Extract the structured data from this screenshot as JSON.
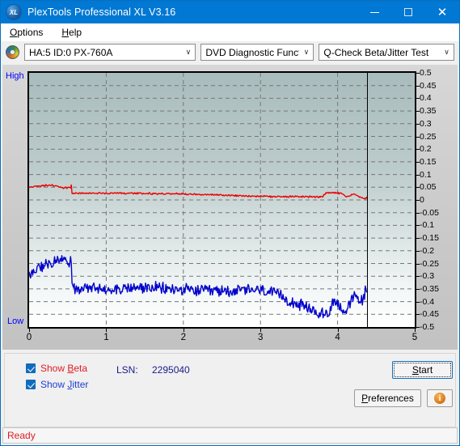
{
  "window": {
    "title": "PlexTools Professional XL V3.16",
    "app_icon": "xl-badge-icon",
    "minimize_label": "–",
    "maximize_label": "□",
    "close_label": "✕"
  },
  "menu": {
    "items": [
      {
        "label": "Options",
        "mnemonic": "O",
        "rest": "ptions"
      },
      {
        "label": "Help",
        "mnemonic": "H",
        "rest": "elp"
      }
    ]
  },
  "toolbar": {
    "drive_icon": "optical-disc-icon",
    "drive_combo": {
      "value": "HA:5 ID:0  PX-760A"
    },
    "function_combo": {
      "value": "DVD Diagnostic Functions"
    },
    "test_combo": {
      "value": "Q-Check Beta/Jitter Test"
    },
    "chevron": "∨"
  },
  "chart_panel": {
    "high_label": "High",
    "low_label": "Low"
  },
  "controls": {
    "show_beta": {
      "label": "Show Beta",
      "pre": "Show ",
      "mnemonic": "B",
      "post": "eta",
      "checked": true,
      "color": "#e01b24"
    },
    "show_jitter": {
      "label": "Show Jitter",
      "pre": "Show ",
      "mnemonic": "J",
      "post": "itter",
      "checked": true,
      "color": "#1f3fd0"
    },
    "lsn_label": "LSN:",
    "lsn_value": "2295040",
    "start_button": {
      "label": "Start",
      "mnemonic": "S",
      "rest": "tart",
      "focused": true
    },
    "preferences_button": {
      "label": "Preferences",
      "mnemonic": "P",
      "rest": "references"
    },
    "info_button": {
      "label": "i",
      "icon": "info-icon"
    }
  },
  "statusbar": {
    "text": "Ready"
  },
  "chart_data": {
    "type": "line",
    "title": "Q-Check Beta/Jitter Test",
    "xlabel": "",
    "ylabel": "",
    "xlim": [
      0,
      5
    ],
    "ylim": [
      -0.5,
      0.5
    ],
    "grid": true,
    "legend": "external-checkboxes",
    "x_ticks": [
      0,
      1,
      2,
      3,
      4,
      5
    ],
    "y_ticks": [
      0.5,
      0.45,
      0.4,
      0.35,
      0.3,
      0.25,
      0.2,
      0.15,
      0.1,
      0.05,
      0,
      -0.05,
      -0.1,
      -0.15,
      -0.2,
      -0.25,
      -0.3,
      -0.35,
      -0.4,
      -0.45,
      -0.5
    ],
    "y_axis_semantic": {
      "top": "High",
      "bottom": "Low"
    },
    "data_end_marker_x": 4.38,
    "colors": {
      "beta": "#ee0000",
      "jitter": "#0000cc",
      "grid": "#777777",
      "axis": "#000000"
    },
    "series": [
      {
        "name": "Beta",
        "color": "#ee0000",
        "noise": 0.004,
        "points": [
          [
            0.0,
            0.05
          ],
          [
            0.05,
            0.052
          ],
          [
            0.1,
            0.053
          ],
          [
            0.15,
            0.055
          ],
          [
            0.2,
            0.057
          ],
          [
            0.25,
            0.058
          ],
          [
            0.3,
            0.058
          ],
          [
            0.35,
            0.056
          ],
          [
            0.4,
            0.05
          ],
          [
            0.45,
            0.048
          ],
          [
            0.5,
            0.048
          ],
          [
            0.54,
            0.049
          ],
          [
            0.55,
            0.062
          ],
          [
            0.555,
            0.026
          ],
          [
            0.6,
            0.026
          ],
          [
            0.7,
            0.026
          ],
          [
            0.9,
            0.027
          ],
          [
            1.1,
            0.026
          ],
          [
            1.3,
            0.026
          ],
          [
            1.5,
            0.025
          ],
          [
            1.7,
            0.025
          ],
          [
            1.9,
            0.024
          ],
          [
            2.1,
            0.023
          ],
          [
            2.3,
            0.021
          ],
          [
            2.5,
            0.019
          ],
          [
            2.7,
            0.017
          ],
          [
            2.9,
            0.015
          ],
          [
            3.1,
            0.014
          ],
          [
            3.3,
            0.013
          ],
          [
            3.5,
            0.013
          ],
          [
            3.7,
            0.012
          ],
          [
            3.8,
            0.012
          ],
          [
            3.85,
            0.028
          ],
          [
            3.95,
            0.028
          ],
          [
            4.05,
            0.026
          ],
          [
            4.1,
            0.015
          ],
          [
            4.15,
            0.016
          ],
          [
            4.2,
            0.024
          ],
          [
            4.25,
            0.018
          ],
          [
            4.3,
            0.01
          ],
          [
            4.35,
            0.004
          ],
          [
            4.38,
            0.01
          ]
        ]
      },
      {
        "name": "Jitter",
        "color": "#0000cc",
        "noise": 0.028,
        "points": [
          [
            0.0,
            -0.3
          ],
          [
            0.04,
            -0.29
          ],
          [
            0.08,
            -0.28
          ],
          [
            0.12,
            -0.272
          ],
          [
            0.16,
            -0.265
          ],
          [
            0.2,
            -0.258
          ],
          [
            0.24,
            -0.252
          ],
          [
            0.28,
            -0.246
          ],
          [
            0.32,
            -0.24
          ],
          [
            0.36,
            -0.236
          ],
          [
            0.4,
            -0.232
          ],
          [
            0.44,
            -0.236
          ],
          [
            0.48,
            -0.245
          ],
          [
            0.52,
            -0.24
          ],
          [
            0.545,
            -0.238
          ],
          [
            0.555,
            -0.35
          ],
          [
            0.6,
            -0.352
          ],
          [
            0.7,
            -0.352
          ],
          [
            0.9,
            -0.35
          ],
          [
            1.1,
            -0.348
          ],
          [
            1.3,
            -0.348
          ],
          [
            1.5,
            -0.345
          ],
          [
            1.7,
            -0.348
          ],
          [
            1.9,
            -0.352
          ],
          [
            2.1,
            -0.356
          ],
          [
            2.3,
            -0.358
          ],
          [
            2.5,
            -0.358
          ],
          [
            2.7,
            -0.356
          ],
          [
            2.9,
            -0.354
          ],
          [
            3.0,
            -0.356
          ],
          [
            3.1,
            -0.362
          ],
          [
            3.2,
            -0.372
          ],
          [
            3.3,
            -0.384
          ],
          [
            3.4,
            -0.398
          ],
          [
            3.5,
            -0.412
          ],
          [
            3.6,
            -0.426
          ],
          [
            3.7,
            -0.438
          ],
          [
            3.8,
            -0.448
          ],
          [
            3.88,
            -0.452
          ],
          [
            3.93,
            -0.4
          ],
          [
            4.0,
            -0.404
          ],
          [
            4.06,
            -0.428
          ],
          [
            4.12,
            -0.438
          ],
          [
            4.18,
            -0.398
          ],
          [
            4.24,
            -0.372
          ],
          [
            4.28,
            -0.4
          ],
          [
            4.32,
            -0.392
          ],
          [
            4.36,
            -0.36
          ],
          [
            4.38,
            -0.358
          ]
        ]
      }
    ]
  }
}
